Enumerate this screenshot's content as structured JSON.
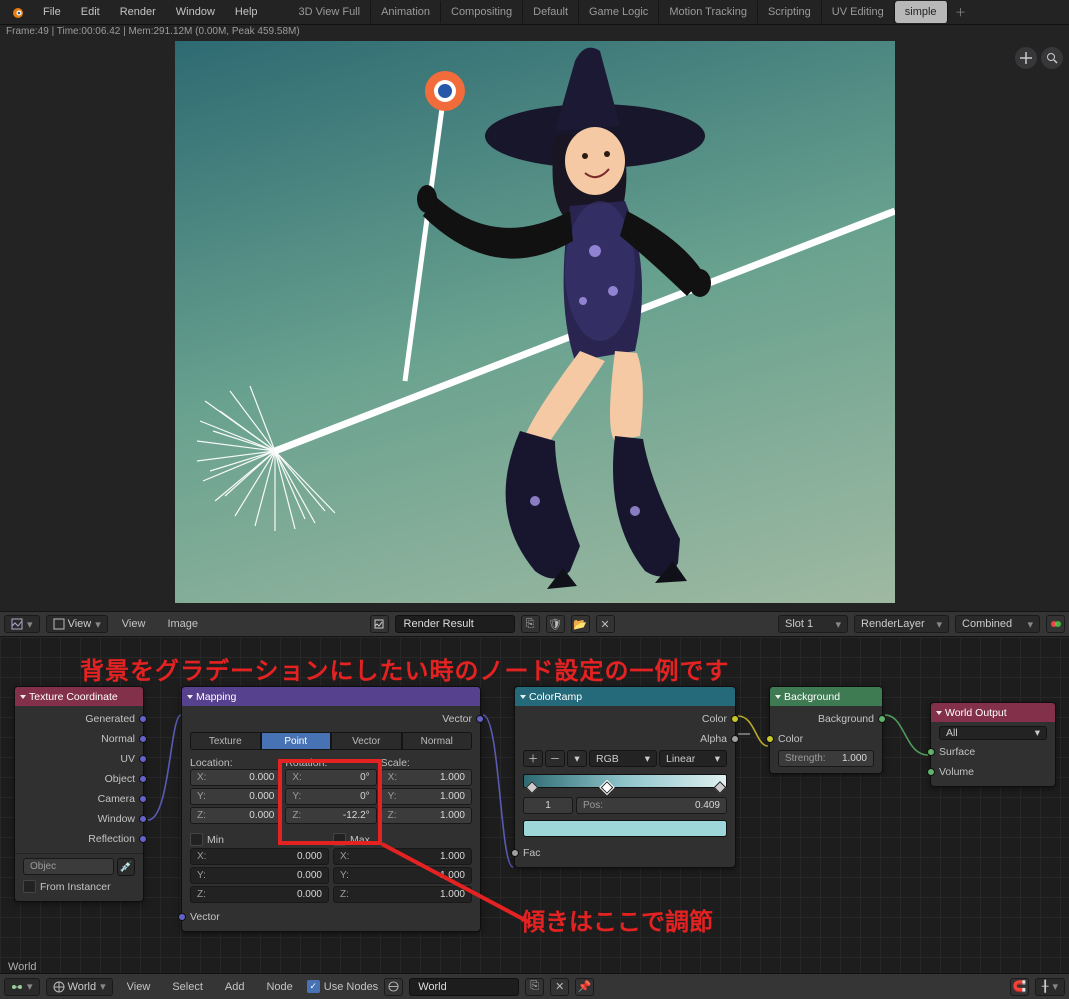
{
  "menu": {
    "file": "File",
    "edit": "Edit",
    "render": "Render",
    "window": "Window",
    "help": "Help"
  },
  "layouts": [
    "3D View Full",
    "Animation",
    "Compositing",
    "Default",
    "Game Logic",
    "Motion Tracking",
    "Scripting",
    "UV Editing",
    "simple"
  ],
  "active_layout": "simple",
  "info_line": "Frame:49 | Time:00:06.42 | Mem:291.12M (0.00M, Peak 459.58M)",
  "img_header": {
    "view": "View",
    "view2": "View",
    "image": "Image",
    "result": "Render Result",
    "slot": "Slot 1",
    "layer": "RenderLayer",
    "pass": "Combined"
  },
  "anno1": "背景をグラデーションにしたい時のノード設定の一例です",
  "anno2": "傾きはここで調節",
  "nodes": {
    "texcoord": {
      "title": "Texture Coordinate",
      "outs": [
        "Generated",
        "Normal",
        "UV",
        "Object",
        "Camera",
        "Window",
        "Reflection"
      ],
      "object": "Objec",
      "from_inst": "From Instancer"
    },
    "mapping": {
      "title": "Mapping",
      "out": "Vector",
      "types": [
        "Texture",
        "Point",
        "Vector",
        "Normal"
      ],
      "active_type": "Point",
      "labels": {
        "loc": "Location:",
        "rot": "Rotation:",
        "scale": "Scale:"
      },
      "loc": {
        "x": "0.000",
        "y": "0.000",
        "z": "0.000"
      },
      "rot": {
        "x": "0°",
        "y": "0°",
        "z": "-12.2°"
      },
      "scale": {
        "x": "1.000",
        "y": "1.000",
        "z": "1.000"
      },
      "min_lbl": "Min",
      "max_lbl": "Max",
      "min": {
        "x": "0.000",
        "y": "0.000",
        "z": "0.000"
      },
      "max": {
        "x": "1.000",
        "y": "1.000",
        "z": "1.000"
      },
      "in": "Vector"
    },
    "colorramp": {
      "title": "ColorRamp",
      "out_color": "Color",
      "out_alpha": "Alpha",
      "mode": "RGB",
      "interp": "Linear",
      "idx_lbl": "1",
      "pos_lbl": "Pos:",
      "pos_val": "0.409",
      "in": "Fac"
    },
    "background": {
      "title": "Background",
      "out": "Background",
      "color": "Color",
      "strength_lbl": "Strength:",
      "strength_val": "1.000"
    },
    "worldout": {
      "title": "World Output",
      "target": "All",
      "surface": "Surface",
      "volume": "Volume"
    }
  },
  "node_path_label": "World",
  "bottom": {
    "browse": "World",
    "view": "View",
    "select": "Select",
    "add": "Add",
    "node": "Node",
    "use_nodes": "Use Nodes",
    "world": "World"
  }
}
